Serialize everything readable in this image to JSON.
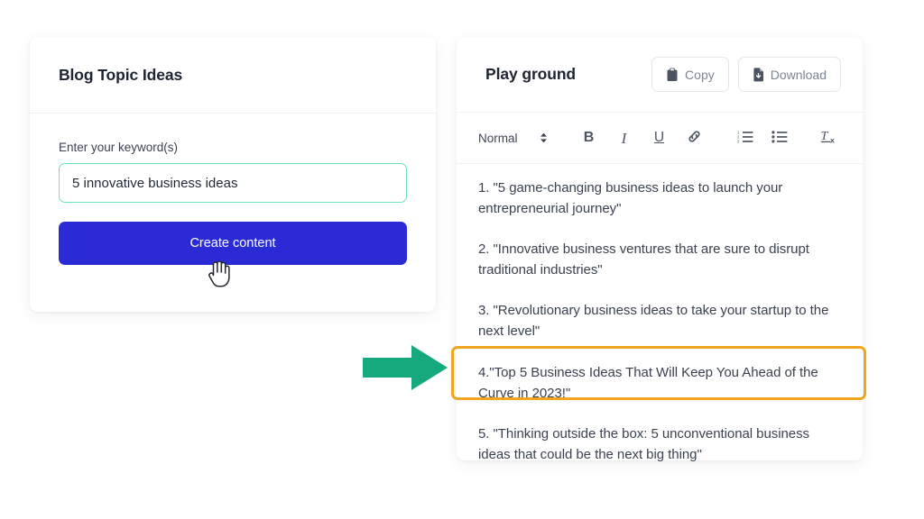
{
  "left_card": {
    "title": "Blog Topic Ideas",
    "form": {
      "keyword_label": "Enter your keyword(s)",
      "keyword_value": "5 innovative business ideas",
      "keyword_placeholder": "Enter your keyword(s)",
      "submit_label": "Create content"
    }
  },
  "right_panel": {
    "title": "Play ground",
    "actions": [
      {
        "label": "Copy",
        "icon": "clipboard-icon"
      },
      {
        "label": "Download",
        "icon": "file-download-icon"
      }
    ],
    "toolbar": {
      "format_label": "Normal",
      "format_caret_icon": "updown-chevron-icon",
      "buttons": [
        {
          "name": "bold",
          "label": "B",
          "icon": "bold-icon"
        },
        {
          "name": "italic",
          "label": "I",
          "icon": "italic-icon"
        },
        {
          "name": "underline",
          "label": "U",
          "icon": "underline-icon"
        },
        {
          "name": "link",
          "label": "",
          "icon": "link-icon"
        },
        {
          "name": "ordered-list",
          "label": "",
          "icon": "ordered-list-icon"
        },
        {
          "name": "bullet-list",
          "label": "",
          "icon": "bullet-list-icon"
        },
        {
          "name": "clear-format",
          "label": "",
          "icon": "clear-format-icon"
        }
      ]
    },
    "content": {
      "items": [
        "1. \"5 game-changing business ideas to launch your entrepreneurial journey\"",
        "2. \"Innovative business ventures that are sure to disrupt traditional industries\"",
        "3. \"Revolutionary business ideas to take your startup to the next level\"",
        "4.\"Top 5 Business Ideas That Will Keep You Ahead of the Curve in 2023!\"",
        "5. \"Thinking outside the box: 5 unconventional business ideas that could be the next big thing\""
      ],
      "highlighted_index": 3
    }
  },
  "annotations": {
    "arrow": {
      "icon": "right-arrow-icon",
      "color": "#17a97e",
      "points_to": "highlighted-item-4"
    },
    "cursor": {
      "icon": "pointing-hand-cursor",
      "over": "create-content-button"
    },
    "highlight_color": "#f0a51e"
  },
  "colors": {
    "primary_button": "#2b2bd6",
    "input_border": "#6fe3bf",
    "highlight": "#f0a51e",
    "arrow_green": "#17a97e",
    "page_background": "#ffffff"
  }
}
